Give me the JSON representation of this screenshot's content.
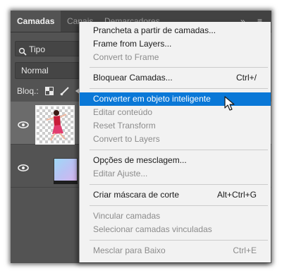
{
  "panel": {
    "tabs": [
      {
        "label": "Camadas"
      },
      {
        "label": "Canais"
      },
      {
        "label": "Demarcadores"
      }
    ],
    "collapse_glyph": "»",
    "menu_glyph": "≡",
    "filter": {
      "label": "Tipo",
      "icon": "search-icon"
    },
    "blend_mode": "Normal",
    "lock_label": "Bloq.:",
    "lock_icons": [
      "lock-transparent-icon",
      "brush-icon",
      "move-icon"
    ],
    "layers": [
      {
        "thumbnail": "dancer-thumbnail",
        "selected": true,
        "visible": true
      },
      {
        "thumbnail": "monitor-thumbnail",
        "selected": false,
        "visible": true
      }
    ]
  },
  "context_menu": {
    "items": [
      {
        "label": "Prancheta a partir de camadas...",
        "shortcut": "",
        "disabled": false,
        "highlighted": false
      },
      {
        "label": "Frame from Layers...",
        "shortcut": "",
        "disabled": false,
        "highlighted": false
      },
      {
        "label": "Convert to Frame",
        "shortcut": "",
        "disabled": true,
        "highlighted": false
      },
      {
        "label": "Bloquear Camadas...",
        "shortcut": "Ctrl+/",
        "disabled": false,
        "highlighted": false
      },
      {
        "label": "Converter em objeto inteligente",
        "shortcut": "",
        "disabled": false,
        "highlighted": true
      },
      {
        "label": "Editar conteúdo",
        "shortcut": "",
        "disabled": true,
        "highlighted": false
      },
      {
        "label": "Reset Transform",
        "shortcut": "",
        "disabled": true,
        "highlighted": false
      },
      {
        "label": "Convert to Layers",
        "shortcut": "",
        "disabled": true,
        "highlighted": false
      },
      {
        "label": "Opções de mesclagem...",
        "shortcut": "",
        "disabled": false,
        "highlighted": false
      },
      {
        "label": "Editar Ajuste...",
        "shortcut": "",
        "disabled": true,
        "highlighted": false
      },
      {
        "label": "Criar máscara de corte",
        "shortcut": "Alt+Ctrl+G",
        "disabled": false,
        "highlighted": false
      },
      {
        "label": "Vincular camadas",
        "shortcut": "",
        "disabled": true,
        "highlighted": false
      },
      {
        "label": "Selecionar camadas vinculadas",
        "shortcut": "",
        "disabled": true,
        "highlighted": false
      },
      {
        "label": "Mesclar para Baixo",
        "shortcut": "Ctrl+E",
        "disabled": true,
        "highlighted": false
      }
    ]
  },
  "colors": {
    "highlight": "#0a78d7",
    "panel_bg": "#535353",
    "menu_bg": "#f2f2f2",
    "disabled_text": "#8c8c8c"
  }
}
